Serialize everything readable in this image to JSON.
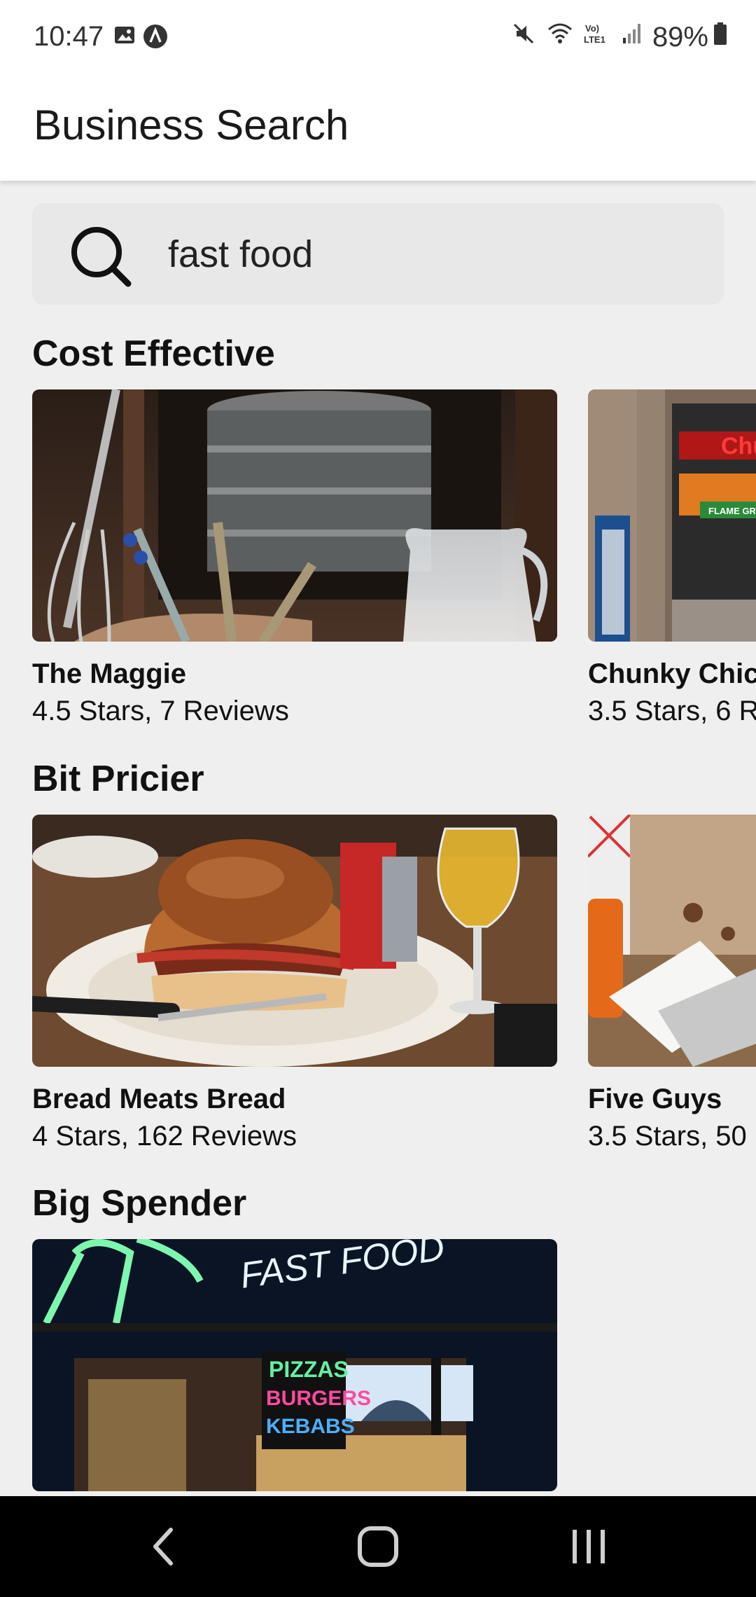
{
  "status_bar": {
    "time": "10:47",
    "battery": "89%",
    "left_icons": [
      "image-icon",
      "a-circle-icon"
    ],
    "right_icons": [
      "mute-icon",
      "wifi-icon",
      "volte-icon",
      "signal-icon",
      "battery-icon"
    ]
  },
  "app_bar": {
    "title": "Business Search"
  },
  "search": {
    "value": "fast food"
  },
  "sections": [
    {
      "title": "Cost Effective",
      "items": [
        {
          "name": "The Maggie",
          "meta": "4.5 Stars, 7 Reviews"
        },
        {
          "name": "Chunky Chic",
          "meta": "3.5 Stars, 6 R"
        }
      ]
    },
    {
      "title": "Bit Pricier",
      "items": [
        {
          "name": "Bread Meats Bread",
          "meta": "4 Stars, 162 Reviews"
        },
        {
          "name": "Five Guys",
          "meta": "3.5 Stars, 50"
        }
      ]
    },
    {
      "title": "Big Spender",
      "items": [
        {
          "name": "",
          "meta": ""
        }
      ]
    }
  ],
  "image_text": {
    "pizza_sign": [
      "PIZZAS",
      "BURGERS",
      "KEBABS"
    ],
    "storefront_banner": "FAST FOOD",
    "chunky_sign": "Chu",
    "flame_grill": "FLAME GRILL"
  },
  "nav_bar": {
    "buttons": [
      "back",
      "home",
      "recents"
    ]
  }
}
